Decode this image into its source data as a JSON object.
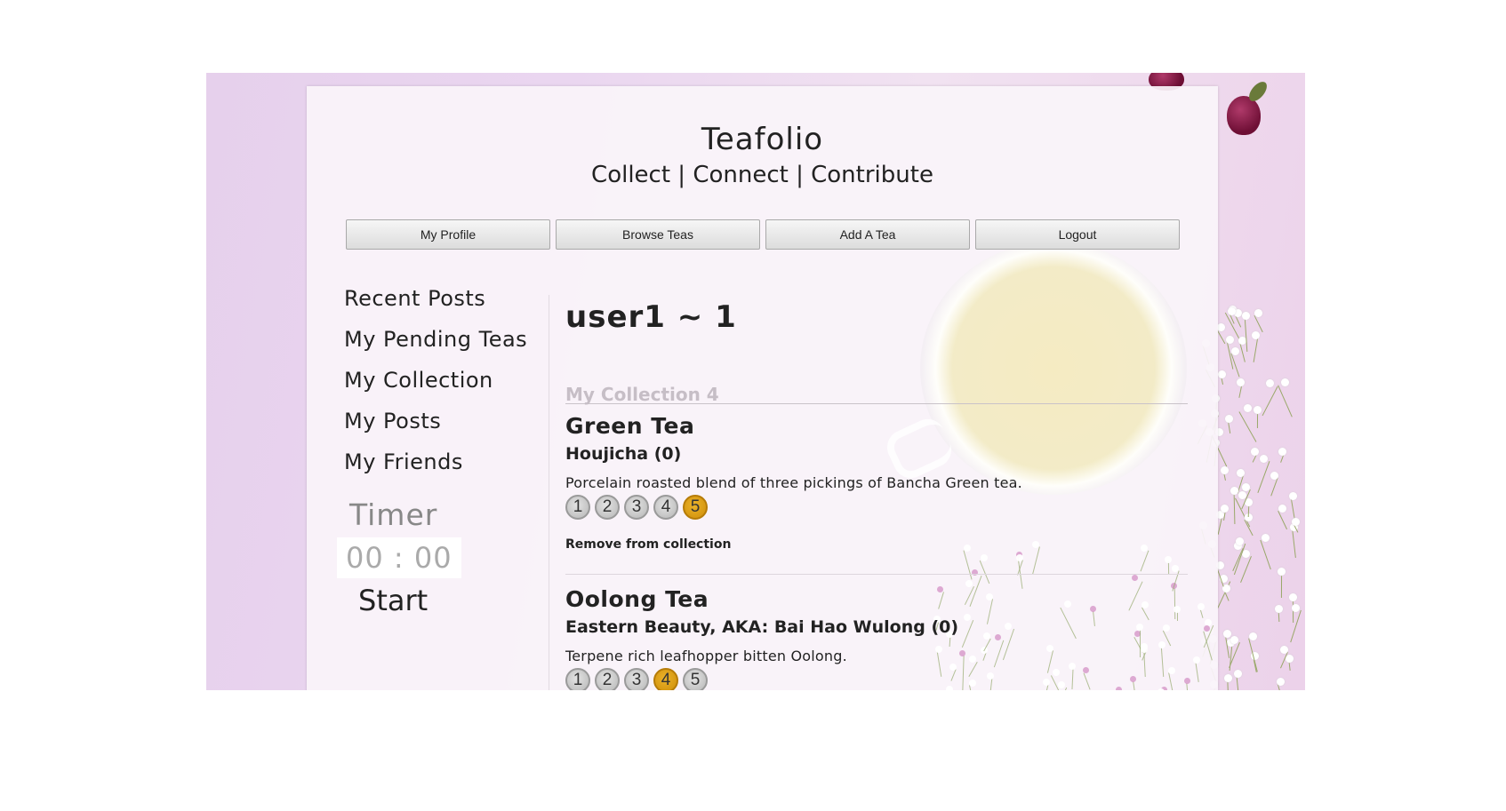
{
  "site": {
    "title": "Teafolio",
    "tagline": "Collect | Connect | Contribute"
  },
  "nav": {
    "items": [
      {
        "label": "My Profile"
      },
      {
        "label": "Browse Teas"
      },
      {
        "label": "Add A Tea"
      },
      {
        "label": "Logout"
      }
    ]
  },
  "sidebar": {
    "items": [
      {
        "label": "Recent Posts"
      },
      {
        "label": "My Pending Teas"
      },
      {
        "label": "My Collection"
      },
      {
        "label": "My Posts"
      },
      {
        "label": "My Friends"
      }
    ],
    "timer": {
      "title": "Timer",
      "display": "00 : 00",
      "start_label": "Start"
    }
  },
  "main": {
    "title": "user1 ~ 1",
    "collection_header": "My Collection 4",
    "teas": [
      {
        "type": "Green Tea",
        "name": "Houjicha (0)",
        "description": "Porcelain roasted blend of three pickings of Bancha Green tea.",
        "ratings": [
          "1",
          "2",
          "3",
          "4",
          "5"
        ],
        "selected_rating": 5,
        "remove_label": "Remove from collection"
      },
      {
        "type": "Oolong Tea",
        "name": "Eastern Beauty, AKA: Bai Hao Wulong (0)",
        "description": "Terpene rich leafhopper bitten Oolong.",
        "ratings": [
          "1",
          "2",
          "3",
          "4",
          "5"
        ],
        "selected_rating": 4
      }
    ]
  },
  "colors": {
    "background": "#e8d2ee",
    "rating_selected": "#d9990f",
    "rating_default": "#c4c4c4"
  }
}
